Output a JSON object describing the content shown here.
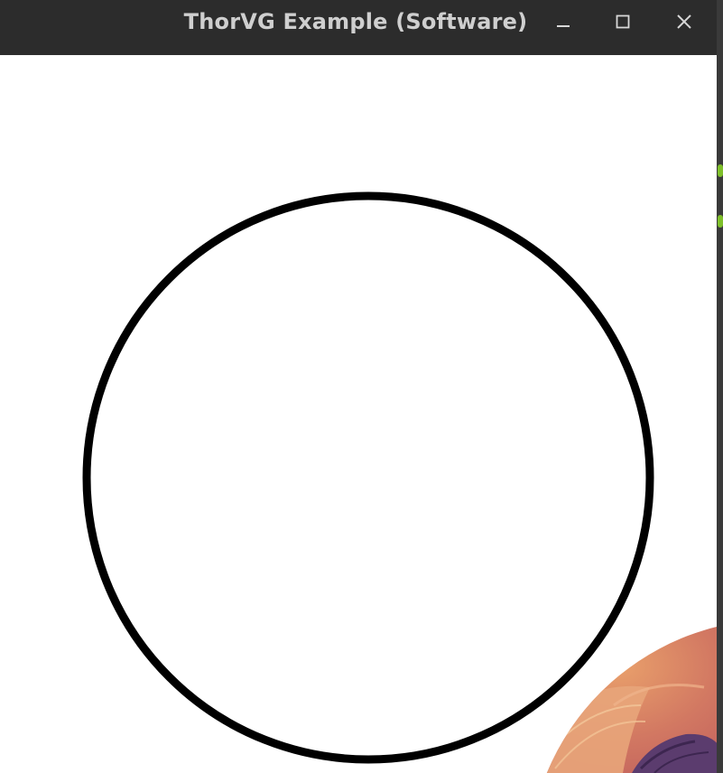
{
  "window": {
    "title": "ThorVG Example (Software)",
    "controls": {
      "minimize": "minimize-icon",
      "maximize": "maximize-icon",
      "close": "close-icon"
    }
  },
  "canvas": {
    "background": "#ffffff",
    "shapes": [
      {
        "kind": "circle-outline",
        "stroke": "#000000",
        "fill": "none"
      },
      {
        "kind": "circular-clipped-picture",
        "description_colors": [
          "#c2615a",
          "#e9a06b",
          "#5a3a6a"
        ]
      }
    ]
  },
  "colors": {
    "titlebar": "#2c2c2c",
    "title_text": "#cfcfcf",
    "accent_green": "#7fc02a"
  }
}
